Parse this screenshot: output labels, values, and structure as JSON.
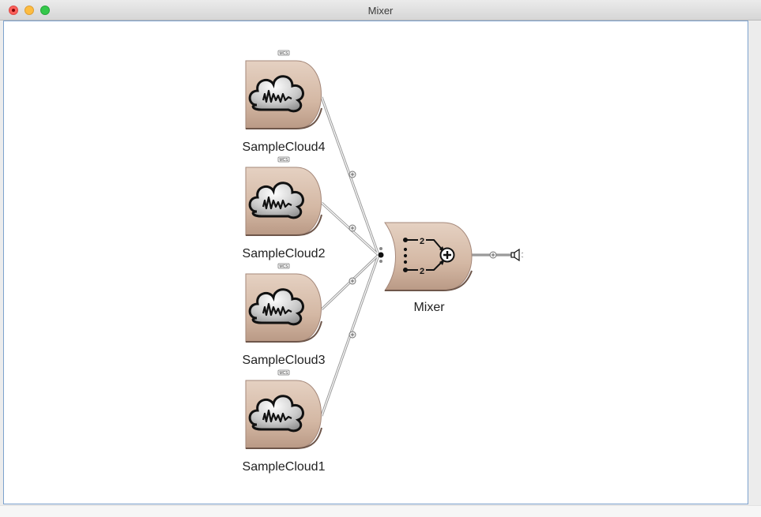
{
  "window": {
    "title": "Mixer"
  },
  "sources": [
    {
      "label": "SampleCloud4",
      "badge": "MCS"
    },
    {
      "label": "SampleCloud2",
      "badge": "MCS"
    },
    {
      "label": "SampleCloud3",
      "badge": "MCS"
    },
    {
      "label": "SampleCloud1",
      "badge": "MCS"
    }
  ],
  "mixer": {
    "label": "Mixer",
    "channel_top": "2",
    "channel_bottom": "2"
  },
  "icons": {
    "source": "sample-cloud-icon",
    "mixer": "mixer-sum-icon",
    "output": "speaker-icon",
    "connection_knot": "plus-knob-icon"
  },
  "colors": {
    "node_fill": "#dcc3b2",
    "canvas_border": "#7da2ce"
  }
}
